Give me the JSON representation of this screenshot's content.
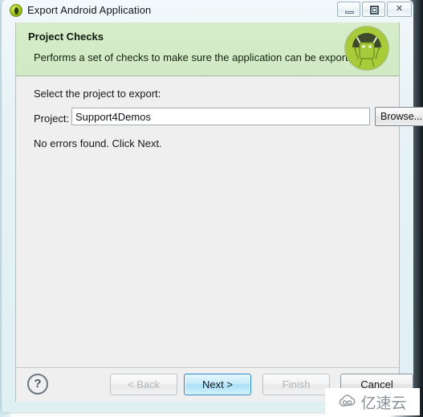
{
  "window": {
    "title": "Export Android Application",
    "title_icon": "android-export-icon",
    "controls": {
      "minimize": "minimize-icon",
      "maximize": "restore-icon",
      "close": "✕"
    }
  },
  "header": {
    "title": "Project Checks",
    "description": "Performs a set of checks to make sure the application can be exported.",
    "icon": "android-robot-icon",
    "background_color": "#d3ebc8"
  },
  "content": {
    "select_label": "Select the project to export:",
    "project_label": "Project:",
    "project_value": "Support4Demos",
    "project_placeholder": "",
    "browse_label": "Browse...",
    "status_text": "No errors found. Click Next."
  },
  "buttons": {
    "help": "?",
    "back": "< Back",
    "next": "Next >",
    "finish": "Finish",
    "cancel": "Cancel"
  },
  "watermark": {
    "text": "亿速云",
    "icon": "cloud-logo-icon"
  },
  "colors": {
    "header_green": "#d3ebc8",
    "dialog_gray": "#efefef",
    "focus_blue": "#2786c4",
    "frame_cyan": "#dff0f3"
  }
}
